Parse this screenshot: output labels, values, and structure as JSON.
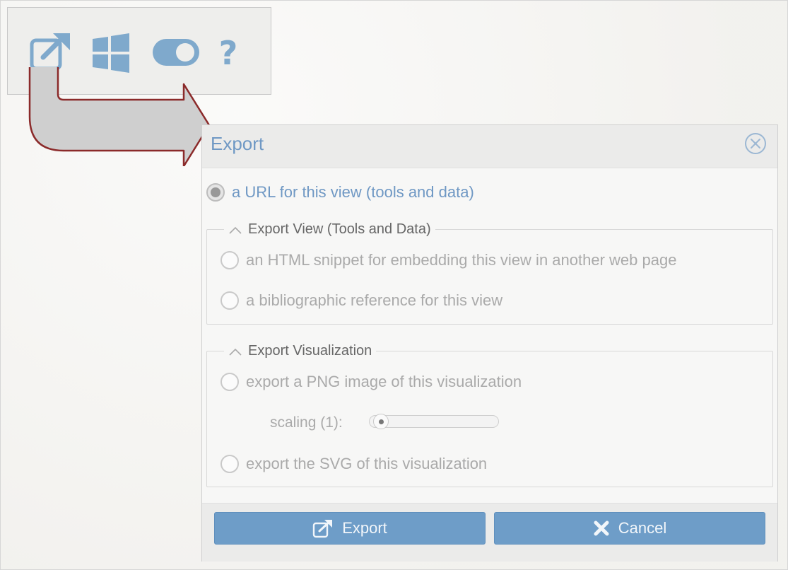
{
  "toolbar": {
    "icons": [
      "export-icon",
      "windows-icon",
      "toggle-icon",
      "help-icon"
    ],
    "help_glyph": "?"
  },
  "dialog": {
    "title": "Export",
    "url_option": "a URL for this view (tools and data)",
    "group_view": {
      "legend": "Export View (Tools and Data)",
      "options": [
        "an HTML snippet for embedding this view in another web page",
        "a bibliographic reference for this view"
      ]
    },
    "group_viz": {
      "legend": "Export Visualization",
      "png_option": "export a PNG image of this visualization",
      "scaling_label": "scaling (1):",
      "scaling_value": 1,
      "svg_option": "export the SVG of this visualization"
    },
    "buttons": {
      "export_label": "Export",
      "cancel_label": "Cancel"
    }
  },
  "colors": {
    "accent": "#6f98c4",
    "button": "#6e9dc8",
    "arrow_stroke": "#8b2a2a",
    "arrow_fill": "#cfcfcf"
  }
}
